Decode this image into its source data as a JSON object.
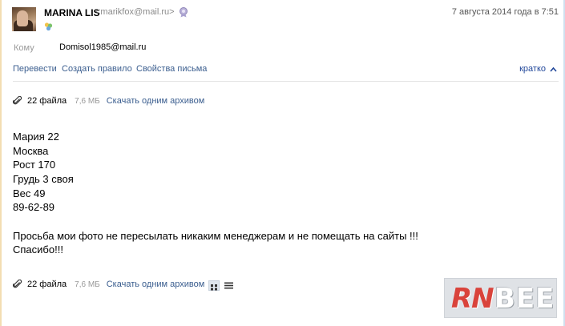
{
  "header": {
    "sender_name": "MARINA LIS",
    "sender_email": "<marikfox@mail.ru>",
    "date": "7 августа 2014 года в 7:51"
  },
  "recipient": {
    "label": "Кому",
    "value": "Domisol1985@mail.ru"
  },
  "actions": {
    "translate": "Перевести",
    "create_rule": "Создать правило",
    "properties": "Свойства письма",
    "brief": "кратко"
  },
  "attachments": {
    "count": "22 файла",
    "size": "7,6 МБ",
    "download": "Скачать одним архивом"
  },
  "body": {
    "lines": [
      "Мария 22",
      "Москва",
      "Рост 170",
      "Грудь 3 своя",
      "Вес 49",
      "89-62-89"
    ],
    "request": "Просьба мои фото не пересылать никаким менеджерам и не помещать на сайты !!!",
    "thanks": "Спасибо!!!"
  },
  "watermark": {
    "part1": "RN",
    "part2": "BEE"
  },
  "icons": {
    "attachment": "paperclip-icon",
    "verified": "medal-icon",
    "status": "people-icon",
    "grid_view": "grid-view-icon",
    "list_view": "list-view-icon"
  },
  "colors": {
    "link": "#3b5e8f",
    "brief_link": "#21479a",
    "muted": "#9a9a9a",
    "watermark_red": "#d9433b"
  }
}
